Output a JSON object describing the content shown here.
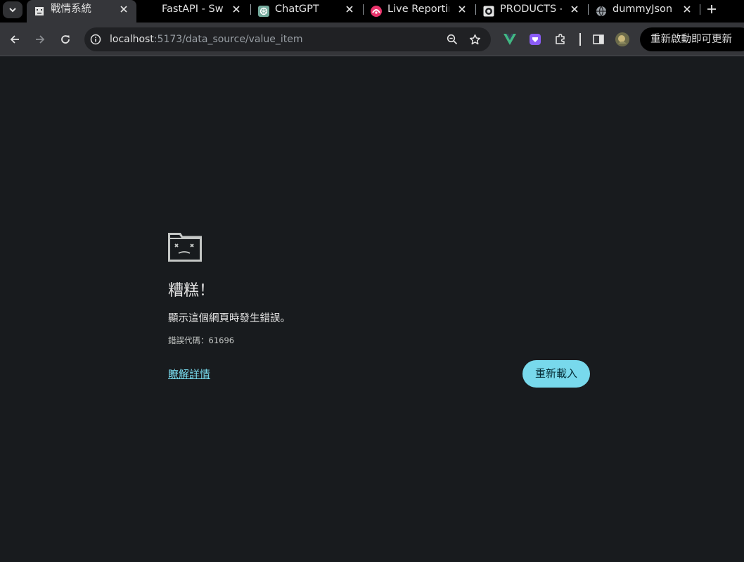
{
  "tabs": [
    {
      "title": "戰情系統",
      "favicon": "broken-page-icon",
      "active": true
    },
    {
      "title": "FastAPI - Swa",
      "favicon": "none"
    },
    {
      "title": "ChatGPT",
      "favicon": "chatgpt-icon"
    },
    {
      "title": "Live Reportin",
      "favicon": "live-reporting-icon"
    },
    {
      "title": "PRODUCTS - I",
      "favicon": "products-icon"
    },
    {
      "title": "dummyJson.c",
      "favicon": "globe-icon"
    }
  ],
  "toolbar": {
    "url_host": "localhost",
    "url_path": ":5173/data_source/value_item",
    "update_label": "重新啟動即可更新"
  },
  "error": {
    "heading": "糟糕！",
    "message": "顯示這個網頁時發生錯誤。",
    "code_label": "錯誤代碼：",
    "code_value": "61696",
    "details_link": "瞭解詳情",
    "reload_label": "重新載入"
  },
  "colors": {
    "page_bg": "#181b1e",
    "accent": "#78d9ec",
    "toolbar_bg": "#35363a",
    "tabstrip_bg": "#000000"
  }
}
